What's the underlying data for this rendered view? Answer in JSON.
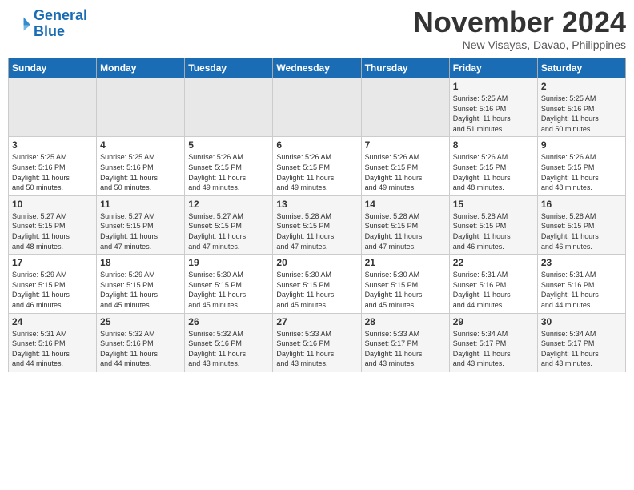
{
  "header": {
    "logo_line1": "General",
    "logo_line2": "Blue",
    "month": "November 2024",
    "location": "New Visayas, Davao, Philippines"
  },
  "weekdays": [
    "Sunday",
    "Monday",
    "Tuesday",
    "Wednesday",
    "Thursday",
    "Friday",
    "Saturday"
  ],
  "weeks": [
    [
      {
        "day": "",
        "info": ""
      },
      {
        "day": "",
        "info": ""
      },
      {
        "day": "",
        "info": ""
      },
      {
        "day": "",
        "info": ""
      },
      {
        "day": "",
        "info": ""
      },
      {
        "day": "1",
        "info": "Sunrise: 5:25 AM\nSunset: 5:16 PM\nDaylight: 11 hours\nand 51 minutes."
      },
      {
        "day": "2",
        "info": "Sunrise: 5:25 AM\nSunset: 5:16 PM\nDaylight: 11 hours\nand 50 minutes."
      }
    ],
    [
      {
        "day": "3",
        "info": "Sunrise: 5:25 AM\nSunset: 5:16 PM\nDaylight: 11 hours\nand 50 minutes."
      },
      {
        "day": "4",
        "info": "Sunrise: 5:25 AM\nSunset: 5:16 PM\nDaylight: 11 hours\nand 50 minutes."
      },
      {
        "day": "5",
        "info": "Sunrise: 5:26 AM\nSunset: 5:15 PM\nDaylight: 11 hours\nand 49 minutes."
      },
      {
        "day": "6",
        "info": "Sunrise: 5:26 AM\nSunset: 5:15 PM\nDaylight: 11 hours\nand 49 minutes."
      },
      {
        "day": "7",
        "info": "Sunrise: 5:26 AM\nSunset: 5:15 PM\nDaylight: 11 hours\nand 49 minutes."
      },
      {
        "day": "8",
        "info": "Sunrise: 5:26 AM\nSunset: 5:15 PM\nDaylight: 11 hours\nand 48 minutes."
      },
      {
        "day": "9",
        "info": "Sunrise: 5:26 AM\nSunset: 5:15 PM\nDaylight: 11 hours\nand 48 minutes."
      }
    ],
    [
      {
        "day": "10",
        "info": "Sunrise: 5:27 AM\nSunset: 5:15 PM\nDaylight: 11 hours\nand 48 minutes."
      },
      {
        "day": "11",
        "info": "Sunrise: 5:27 AM\nSunset: 5:15 PM\nDaylight: 11 hours\nand 47 minutes."
      },
      {
        "day": "12",
        "info": "Sunrise: 5:27 AM\nSunset: 5:15 PM\nDaylight: 11 hours\nand 47 minutes."
      },
      {
        "day": "13",
        "info": "Sunrise: 5:28 AM\nSunset: 5:15 PM\nDaylight: 11 hours\nand 47 minutes."
      },
      {
        "day": "14",
        "info": "Sunrise: 5:28 AM\nSunset: 5:15 PM\nDaylight: 11 hours\nand 47 minutes."
      },
      {
        "day": "15",
        "info": "Sunrise: 5:28 AM\nSunset: 5:15 PM\nDaylight: 11 hours\nand 46 minutes."
      },
      {
        "day": "16",
        "info": "Sunrise: 5:28 AM\nSunset: 5:15 PM\nDaylight: 11 hours\nand 46 minutes."
      }
    ],
    [
      {
        "day": "17",
        "info": "Sunrise: 5:29 AM\nSunset: 5:15 PM\nDaylight: 11 hours\nand 46 minutes."
      },
      {
        "day": "18",
        "info": "Sunrise: 5:29 AM\nSunset: 5:15 PM\nDaylight: 11 hours\nand 45 minutes."
      },
      {
        "day": "19",
        "info": "Sunrise: 5:30 AM\nSunset: 5:15 PM\nDaylight: 11 hours\nand 45 minutes."
      },
      {
        "day": "20",
        "info": "Sunrise: 5:30 AM\nSunset: 5:15 PM\nDaylight: 11 hours\nand 45 minutes."
      },
      {
        "day": "21",
        "info": "Sunrise: 5:30 AM\nSunset: 5:15 PM\nDaylight: 11 hours\nand 45 minutes."
      },
      {
        "day": "22",
        "info": "Sunrise: 5:31 AM\nSunset: 5:16 PM\nDaylight: 11 hours\nand 44 minutes."
      },
      {
        "day": "23",
        "info": "Sunrise: 5:31 AM\nSunset: 5:16 PM\nDaylight: 11 hours\nand 44 minutes."
      }
    ],
    [
      {
        "day": "24",
        "info": "Sunrise: 5:31 AM\nSunset: 5:16 PM\nDaylight: 11 hours\nand 44 minutes."
      },
      {
        "day": "25",
        "info": "Sunrise: 5:32 AM\nSunset: 5:16 PM\nDaylight: 11 hours\nand 44 minutes."
      },
      {
        "day": "26",
        "info": "Sunrise: 5:32 AM\nSunset: 5:16 PM\nDaylight: 11 hours\nand 43 minutes."
      },
      {
        "day": "27",
        "info": "Sunrise: 5:33 AM\nSunset: 5:16 PM\nDaylight: 11 hours\nand 43 minutes."
      },
      {
        "day": "28",
        "info": "Sunrise: 5:33 AM\nSunset: 5:17 PM\nDaylight: 11 hours\nand 43 minutes."
      },
      {
        "day": "29",
        "info": "Sunrise: 5:34 AM\nSunset: 5:17 PM\nDaylight: 11 hours\nand 43 minutes."
      },
      {
        "day": "30",
        "info": "Sunrise: 5:34 AM\nSunset: 5:17 PM\nDaylight: 11 hours\nand 43 minutes."
      }
    ]
  ]
}
